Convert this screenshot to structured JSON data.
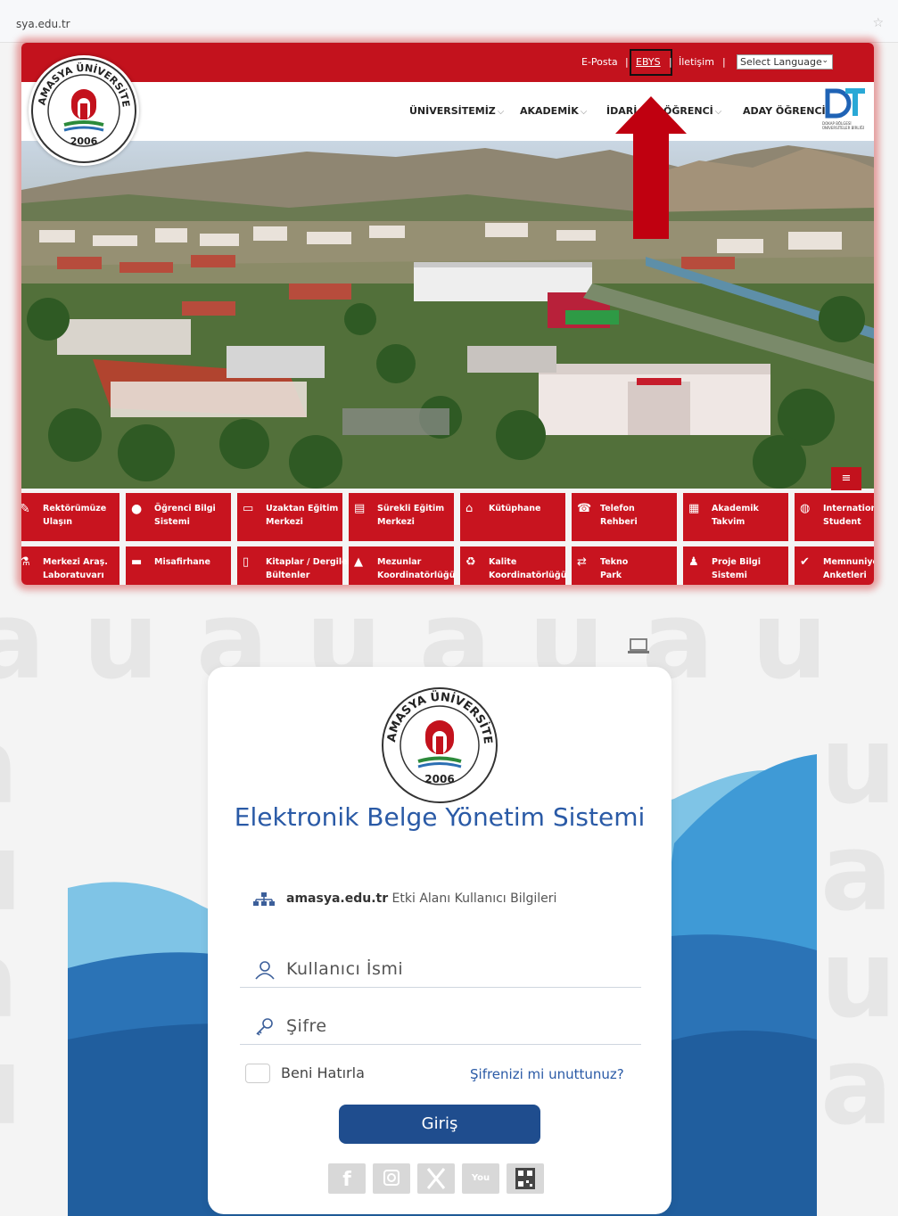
{
  "browser": {
    "url": "sya.edu.tr"
  },
  "site": {
    "topbar": {
      "links": [
        "E-Posta",
        "EBYS",
        "İletişim"
      ],
      "separator": "|",
      "language_select": "Select Language"
    },
    "logo": {
      "text_top": "AMASYA ÜNİVERSİTESİ",
      "year": "2006"
    },
    "nav": [
      "ÜNİVERSİTEMİZ",
      "AKADEMİK",
      "İDARİ",
      "ÖĞRENCİ",
      "ADAY ÖĞRENCİ"
    ],
    "dokap": {
      "caption": "DOKAP BÖLGESİ ÜNİVERSİTELER BİRLİĞİ"
    },
    "hamburger": "≡",
    "quick_links": [
      "Rektörümüze\nUlaşın",
      "Öğrenci Bilgi\nSistemi",
      "Uzaktan Eğitim\nMerkezi",
      "Sürekli Eğitim\nMerkezi",
      "Kütüphane",
      "Telefon\nRehberi",
      "Akademik\nTakvim",
      "International\nStudent",
      "Merkezi Araş.\nLaboratuvarı",
      "Misafirhane",
      "Kitaplar / Dergiler\nBültenler",
      "Mezunlar\nKoordinatörlüğü",
      "Kalite\nKoordinatörlüğü",
      "Tekno\nPark",
      "Proje Bilgi\nSistemi",
      "Memnuniyet\nAnketleri"
    ]
  },
  "login": {
    "title": "Elektronik Belge Yönetim Sistemi",
    "domain_bold": "amasya.edu.tr",
    "domain_rest": " Etki Alanı Kullanıcı Bilgileri",
    "username_placeholder": "Kullanıcı İsmi",
    "password_placeholder": "Şifre",
    "remember_label": "Beni Hatırla",
    "forgot_link": "Şifrenizi mi unuttunuz?",
    "login_button": "Giriş",
    "social": [
      "facebook-icon",
      "instagram-icon",
      "x-icon",
      "youtube-icon",
      "qr-code-icon"
    ],
    "logo": {
      "text_top": "AMASYA ÜNİVERSİTESİ",
      "year": "2006"
    }
  },
  "colors": {
    "brand_red": "#c3121d",
    "brand_blue": "#2a5aa6",
    "button_blue": "#1f4d8e",
    "arrow_red": "#c00010"
  }
}
